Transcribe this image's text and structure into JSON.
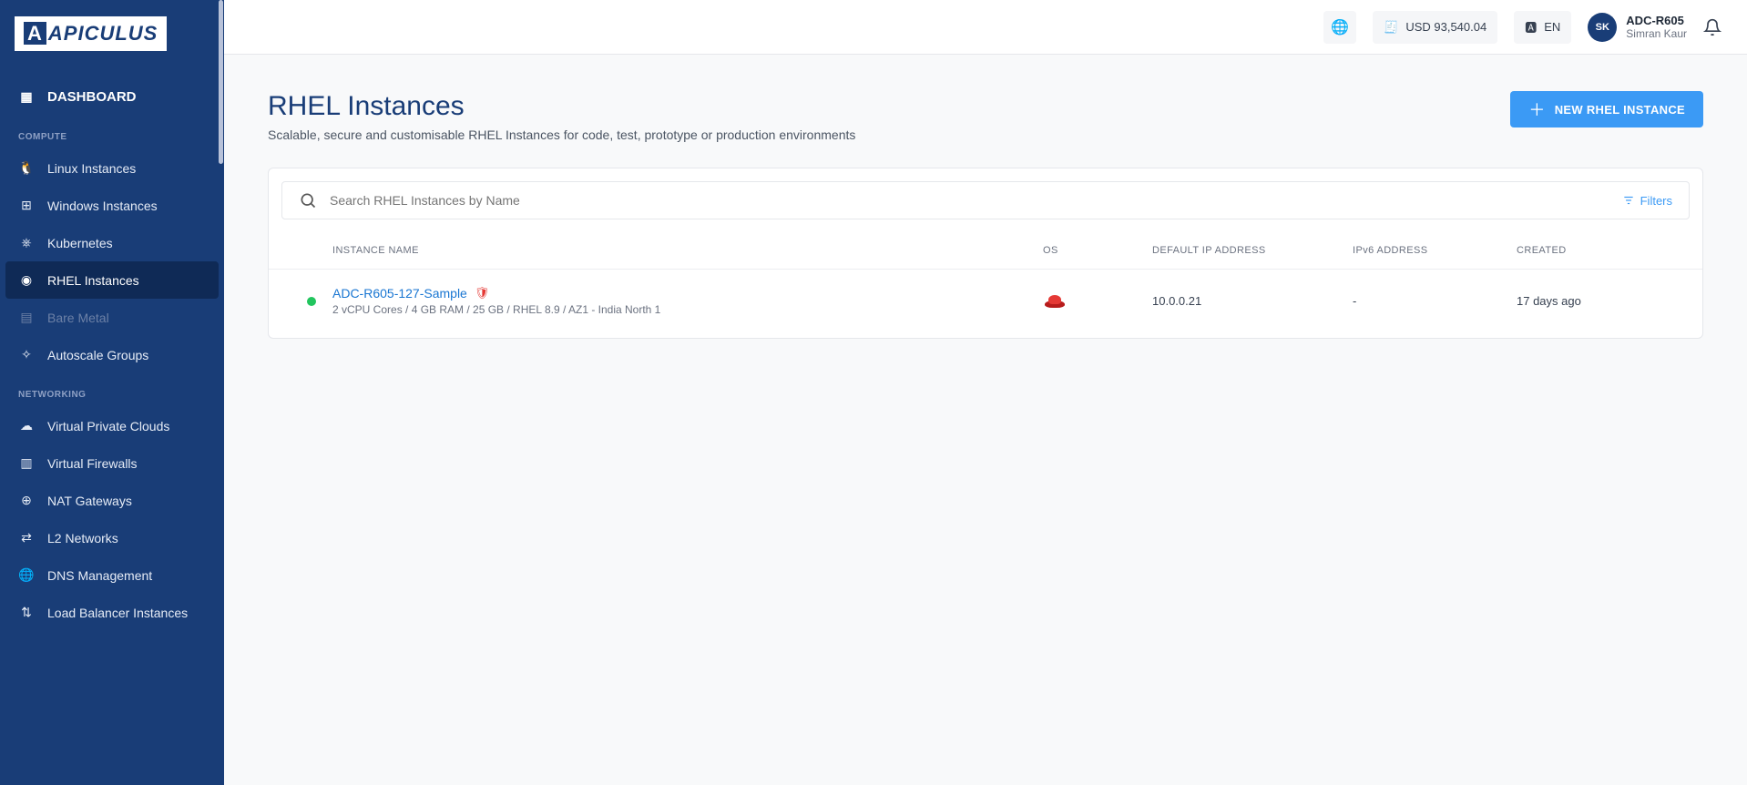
{
  "brand": "APICULUS",
  "topbar": {
    "balance": "USD 93,540.04",
    "language": "EN",
    "account_code": "ADC-R605",
    "user_name": "Simran Kaur",
    "avatar_initials": "SK"
  },
  "sidebar": {
    "dashboard": "DASHBOARD",
    "sections": {
      "compute": "COMPUTE",
      "networking": "NETWORKING"
    },
    "items": {
      "linux": "Linux Instances",
      "windows": "Windows Instances",
      "kubernetes": "Kubernetes",
      "rhel": "RHEL Instances",
      "baremetal": "Bare Metal",
      "autoscale": "Autoscale Groups",
      "vpc": "Virtual Private Clouds",
      "vfw": "Virtual Firewalls",
      "nat": "NAT Gateways",
      "l2": "L2 Networks",
      "dns": "DNS Management",
      "lb": "Load Balancer Instances"
    }
  },
  "page": {
    "title": "RHEL Instances",
    "subtitle": "Scalable, secure and customisable RHEL Instances for code, test, prototype or production environments",
    "new_button": "NEW RHEL INSTANCE",
    "search_placeholder": "Search RHEL Instances by Name",
    "filters_label": "Filters"
  },
  "table": {
    "headers": {
      "name": "INSTANCE NAME",
      "os": "OS",
      "ip": "DEFAULT IP ADDRESS",
      "ipv6": "IPv6 ADDRESS",
      "created": "CREATED"
    },
    "rows": [
      {
        "name": "ADC-R605-127-Sample",
        "spec": "2 vCPU Cores / 4 GB RAM / 25 GB / RHEL 8.9 / AZ1 - India North 1",
        "ip": "10.0.0.21",
        "ipv6": "-",
        "created": "17 days ago"
      }
    ]
  }
}
